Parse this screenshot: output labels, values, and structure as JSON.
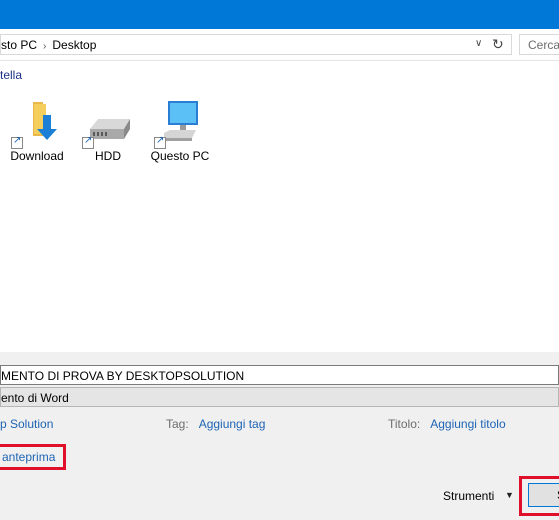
{
  "address": {
    "crumbs": [
      "sto PC",
      "Desktop"
    ],
    "separator": "›",
    "dropdown_icon": "chevron-down",
    "refresh_icon": "refresh"
  },
  "search": {
    "placeholder": "Cerca"
  },
  "command_bar": {
    "new_folder_label": "tella"
  },
  "files": [
    {
      "label": "Download",
      "icon": "download-folder-icon"
    },
    {
      "label": "HDD",
      "icon": "drive-icon"
    },
    {
      "label": "Questo PC",
      "icon": "computer-icon"
    }
  ],
  "form": {
    "filename": "MENTO DI PROVA BY DESKTOPSOLUTION",
    "filetype": "ento di Word",
    "author": "p Solution",
    "tags_label": "Tag:",
    "tags_value": "Aggiungi tag",
    "title_label": "Titolo:",
    "title_value": "Aggiungi titolo",
    "preview_label": "anteprima",
    "tools_label": "Strumenti",
    "save_label": "S"
  },
  "colors": {
    "titlebar": "#0078d7",
    "link": "#1e64b4",
    "highlight": "#e0102a"
  }
}
